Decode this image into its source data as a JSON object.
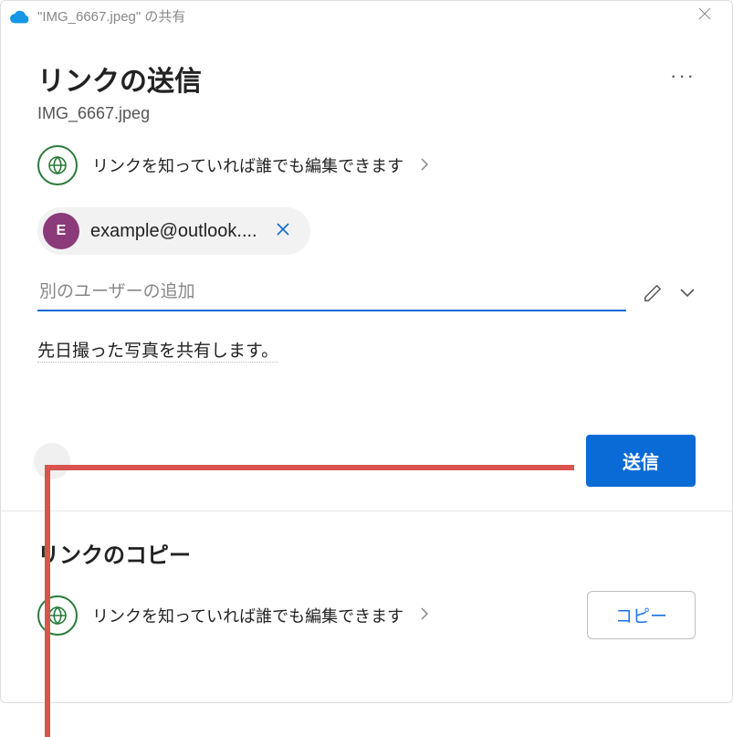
{
  "window": {
    "title": "\"IMG_6667.jpeg\" の共有"
  },
  "header": {
    "title": "リンクの送信",
    "filename": "IMG_6667.jpeg"
  },
  "permission": {
    "label": "リンクを知っていれば誰でも編集できます"
  },
  "recipient": {
    "avatar_letter": "E",
    "email": "example@outlook...."
  },
  "add_user": {
    "placeholder": "別のユーザーの追加"
  },
  "message": {
    "text": "先日撮った写真を共有します。"
  },
  "buttons": {
    "send": "送信",
    "copy": "コピー"
  },
  "copy_section": {
    "title": "リンクのコピー",
    "permission_label": "リンクを知っていれば誰でも編集できます"
  }
}
